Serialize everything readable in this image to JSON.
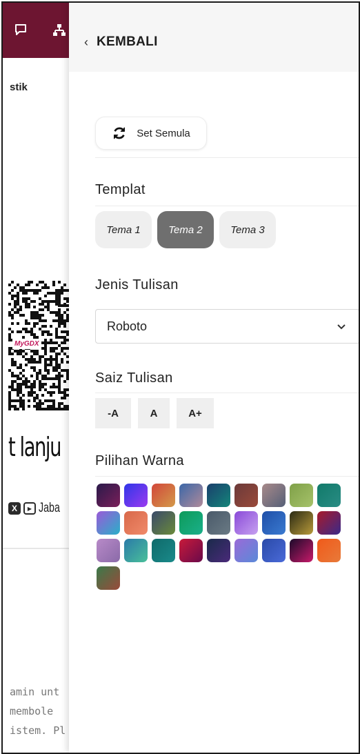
{
  "background": {
    "heading": "stik",
    "qr_badge": "MyGDX",
    "big_text": "t lanju",
    "social_label": "Jaba",
    "paragraph_lines": [
      "amin unt",
      "membole",
      "istem. Pl"
    ]
  },
  "panel": {
    "back_label": "KEMBALI",
    "reset_label": "Set Semula",
    "template": {
      "title": "Templat",
      "options": [
        "Tema 1",
        "Tema 2",
        "Tema 3"
      ],
      "selected": "Tema 2"
    },
    "font": {
      "title": "Jenis Tulisan",
      "selected": "Roboto"
    },
    "size": {
      "title": "Saiz Tulisan",
      "options": [
        "-A",
        "A",
        "A+"
      ]
    },
    "colors": {
      "title": "Pilihan Warna",
      "swatches": [
        [
          "#2a1a4a",
          "#7b1f5a"
        ],
        [
          "#2f36e8",
          "#9b3bf0"
        ],
        [
          "#d2473a",
          "#d39a4a"
        ],
        [
          "#3b67a8",
          "#b08a9a"
        ],
        [
          "#1a3f6c",
          "#14857a"
        ],
        [
          "#6b3a3a",
          "#9a4a3a"
        ],
        [
          "#a88a8a",
          "#555f77"
        ],
        [
          "#7fa048",
          "#a6c26a"
        ],
        [
          "#117a6a",
          "#2a8c84"
        ],
        [
          "#9a5ad8",
          "#29b0c8"
        ],
        [
          "#d8684a",
          "#f08a6a"
        ],
        [
          "#3a4a6a",
          "#6a8a3a"
        ],
        [
          "#0e9a5a",
          "#1ab08a"
        ],
        [
          "#4a5a6a",
          "#6a7a84"
        ],
        [
          "#8a4ad8",
          "#c6a0f0"
        ],
        [
          "#1f4fa8",
          "#3a7ad0"
        ],
        [
          "#2a2a14",
          "#b89a3a"
        ],
        [
          "#a81a2a",
          "#3a2a8a"
        ],
        [
          "#b88ac8",
          "#8a6aa8"
        ],
        [
          "#2a7aa8",
          "#4ac09a"
        ],
        [
          "#0f6a6a",
          "#1a8a8a"
        ],
        [
          "#c81a3a",
          "#6a0a4a"
        ],
        [
          "#1a2a4a",
          "#4a2a7a"
        ],
        [
          "#9a6ad8",
          "#5a8ad8"
        ],
        [
          "#2a4aa8",
          "#4a6ad8"
        ],
        [
          "#1a0a2a",
          "#c81a6a"
        ],
        [
          "#f05a1a",
          "#e87a3a"
        ],
        [
          "#3a7a4a",
          "#9a4a3a"
        ]
      ]
    }
  }
}
